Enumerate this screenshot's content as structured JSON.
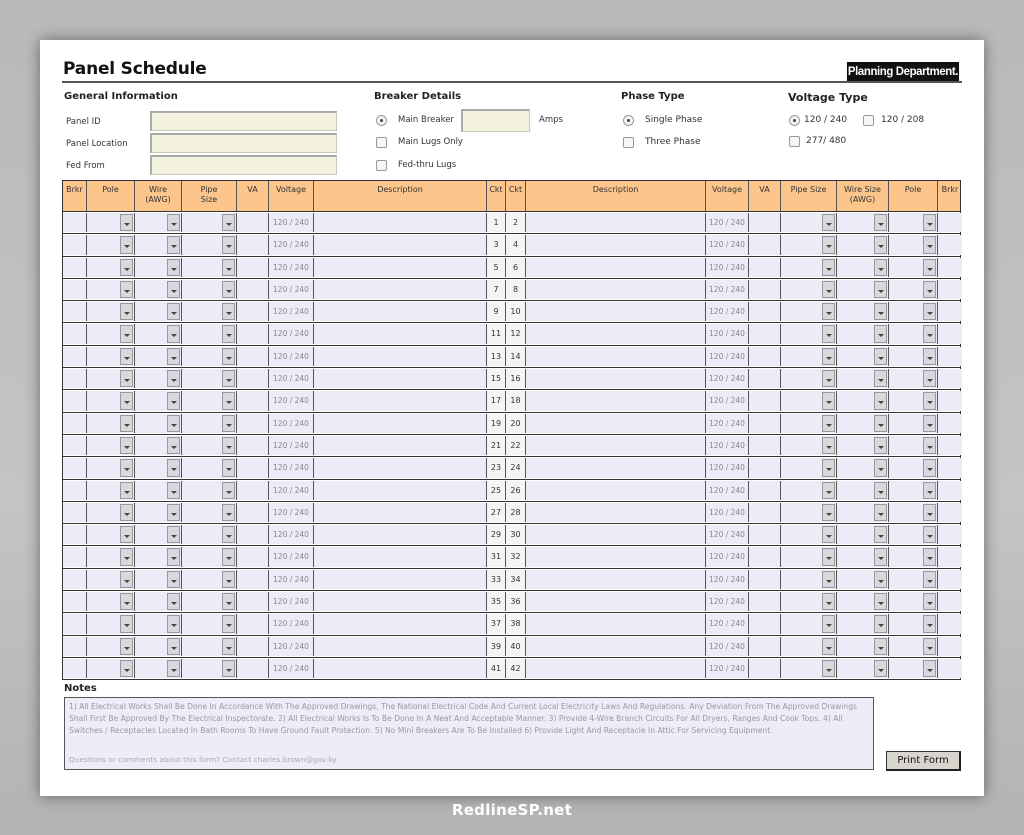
{
  "header": {
    "title": "Panel Schedule",
    "brand": "Planning Department."
  },
  "general_info": {
    "heading": "General Information",
    "fields": [
      {
        "label": "Panel ID",
        "value": ""
      },
      {
        "label": "Panel Location",
        "value": ""
      },
      {
        "label": "Fed From",
        "value": ""
      }
    ]
  },
  "breaker_details": {
    "heading": "Breaker Details",
    "options": [
      {
        "label": "Main Breaker",
        "selected": true
      },
      {
        "label": "Main Lugs Only",
        "selected": false
      },
      {
        "label": "Fed-thru Lugs",
        "selected": false
      }
    ],
    "amps_value": "",
    "amps_label": "Amps"
  },
  "phase_type": {
    "heading": "Phase Type",
    "options": [
      {
        "label": "Single Phase",
        "selected": true
      },
      {
        "label": "Three Phase",
        "selected": false
      }
    ]
  },
  "voltage_type": {
    "heading": "Voltage Type",
    "options": [
      {
        "label": "120 / 240",
        "selected": true
      },
      {
        "label": "120 / 208",
        "selected": false
      },
      {
        "label": "277/ 480",
        "selected": false
      }
    ]
  },
  "table": {
    "headers": [
      "Brkr",
      "Pole",
      "Wire\n(AWG)",
      "Pipe\nSize",
      "VA",
      "Voltage",
      "Description",
      "Ckt",
      "Ckt",
      "Description",
      "Voltage",
      "VA",
      "Pipe Size",
      "Wire Size\n(AWG)",
      "Pole",
      "Brkr"
    ],
    "default_voltage": "120 / 240",
    "rows": [
      {
        "left_ckt": "1",
        "right_ckt": "2"
      },
      {
        "left_ckt": "3",
        "right_ckt": "4"
      },
      {
        "left_ckt": "5",
        "right_ckt": "6"
      },
      {
        "left_ckt": "7",
        "right_ckt": "8"
      },
      {
        "left_ckt": "9",
        "right_ckt": "10"
      },
      {
        "left_ckt": "11",
        "right_ckt": "12"
      },
      {
        "left_ckt": "13",
        "right_ckt": "14"
      },
      {
        "left_ckt": "15",
        "right_ckt": "16"
      },
      {
        "left_ckt": "17",
        "right_ckt": "18"
      },
      {
        "left_ckt": "19",
        "right_ckt": "20"
      },
      {
        "left_ckt": "21",
        "right_ckt": "22"
      },
      {
        "left_ckt": "23",
        "right_ckt": "24"
      },
      {
        "left_ckt": "25",
        "right_ckt": "26"
      },
      {
        "left_ckt": "27",
        "right_ckt": "28"
      },
      {
        "left_ckt": "29",
        "right_ckt": "30"
      },
      {
        "left_ckt": "31",
        "right_ckt": "32"
      },
      {
        "left_ckt": "33",
        "right_ckt": "34"
      },
      {
        "left_ckt": "35",
        "right_ckt": "36"
      },
      {
        "left_ckt": "37",
        "right_ckt": "38"
      },
      {
        "left_ckt": "39",
        "right_ckt": "40"
      },
      {
        "left_ckt": "41",
        "right_ckt": "42"
      }
    ]
  },
  "notes": {
    "heading": "Notes",
    "text": "1) All Electrical Works Shall Be Done In Accordance With The Approved Drawings, The National Electrical Code And Current Local Electricity Laws And Regulations. Any Deviation From The Approved Drawings Shall First Be Approved By The Electrical Inspectorate.  2) All Electrical Works Is To Be Done In A Neat And Acceptable Manner.  3) Provide 4-Wire Branch Circuits For All Dryers, Ranges And Cook Tops.  4) All Switches / Receptacles Located In Bath Rooms To Have Ground Fault Protection.   5) No Mini Breakers Are To Be Installed   6) Provide Light And Receptacle In Attic For Servicing Equipment.",
    "contact": "Questions or comments about this form? Contact charles.brown@gov.ky"
  },
  "print_button": "Print Form",
  "watermark": "RedlineSP.net"
}
